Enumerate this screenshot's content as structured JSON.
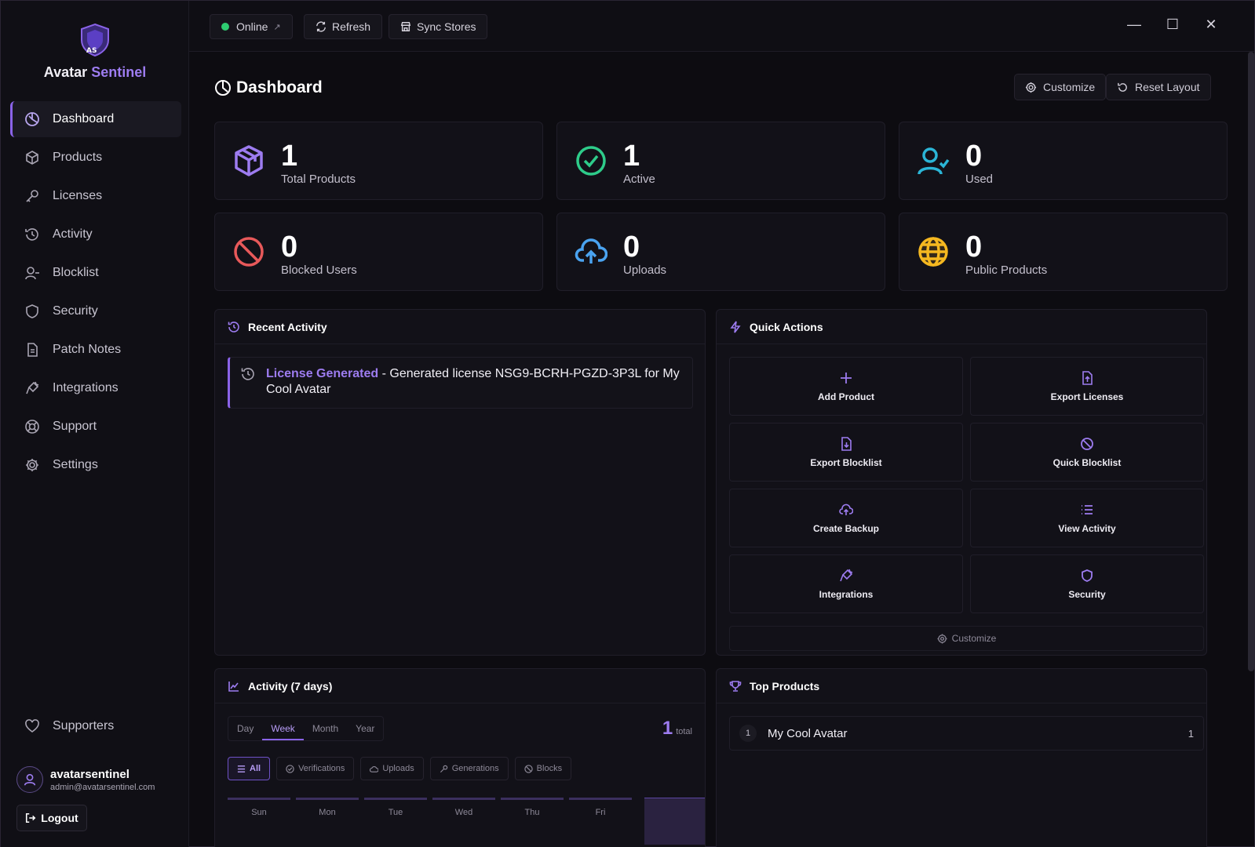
{
  "brand": {
    "first": "Avatar",
    "second": "Sentinel",
    "logo_text": "AS"
  },
  "nav": [
    {
      "label": "Dashboard",
      "icon": "dashboard-icon"
    },
    {
      "label": "Products",
      "icon": "box-icon"
    },
    {
      "label": "Licenses",
      "icon": "key-icon"
    },
    {
      "label": "Activity",
      "icon": "history-icon"
    },
    {
      "label": "Blocklist",
      "icon": "user-minus-icon"
    },
    {
      "label": "Security",
      "icon": "shield-icon"
    },
    {
      "label": "Patch Notes",
      "icon": "document-icon"
    },
    {
      "label": "Integrations",
      "icon": "plug-icon"
    },
    {
      "label": "Support",
      "icon": "lifebuoy-icon"
    },
    {
      "label": "Settings",
      "icon": "gear-icon"
    }
  ],
  "supporters_label": "Supporters",
  "user": {
    "name": "avatarsentinel",
    "email": "admin@avatarsentinel.com",
    "logout": "Logout"
  },
  "topbar": {
    "status": "Online",
    "refresh": "Refresh",
    "sync": "Sync Stores"
  },
  "page": {
    "title": "Dashboard",
    "customize": "Customize",
    "reset": "Reset Layout"
  },
  "stats": [
    {
      "value": "1",
      "label": "Total Products",
      "color": "#9d7cf0"
    },
    {
      "value": "1",
      "label": "Active",
      "color": "#2ecc8a"
    },
    {
      "value": "0",
      "label": "Used",
      "color": "#2bb5d6"
    },
    {
      "value": "0",
      "label": "Blocked Users",
      "color": "#e8595a"
    },
    {
      "value": "0",
      "label": "Uploads",
      "color": "#4aa3f0"
    },
    {
      "value": "0",
      "label": "Public Products",
      "color": "#f5b820"
    }
  ],
  "recent": {
    "title": "Recent Activity",
    "item_link": "License Generated",
    "item_text": " - Generated license NSG9-BCRH-PGZD-3P3L for My Cool Avatar"
  },
  "quick": {
    "title": "Quick Actions",
    "actions": [
      "Add Product",
      "Export Licenses",
      "Export Blocklist",
      "Quick Blocklist",
      "Create Backup",
      "View Activity",
      "Integrations",
      "Security"
    ],
    "customize": "Customize"
  },
  "activity": {
    "title": "Activity (7 days)",
    "ranges": [
      "Day",
      "Week",
      "Month",
      "Year"
    ],
    "active_range": "Week",
    "total_value": "1",
    "total_label": "total",
    "filters": [
      "All",
      "Verifications",
      "Uploads",
      "Generations",
      "Blocks"
    ],
    "days": [
      "Sun",
      "Mon",
      "Tue",
      "Wed",
      "Thu",
      "Fri"
    ]
  },
  "top": {
    "title": "Top Products",
    "items": [
      {
        "rank": "1",
        "name": "My Cool Avatar",
        "count": "1"
      }
    ]
  }
}
